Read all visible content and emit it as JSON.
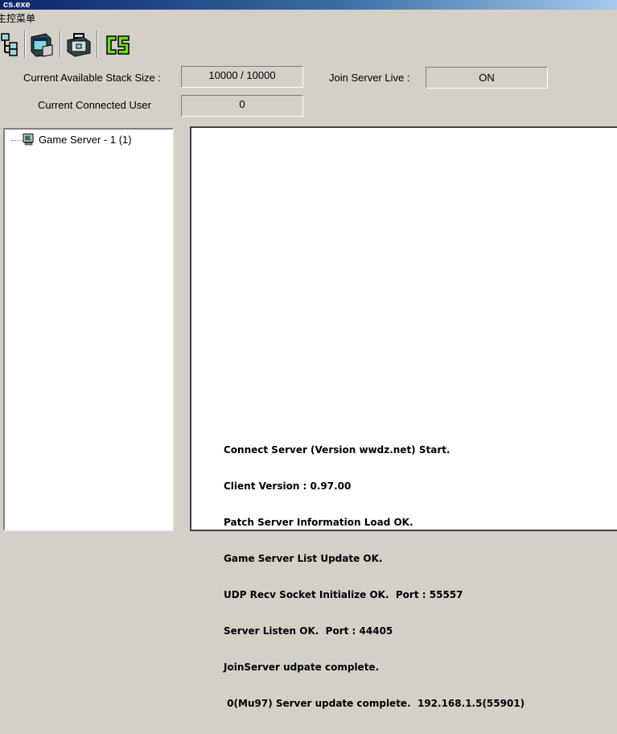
{
  "window": {
    "title": "cs.exe"
  },
  "menu": {
    "items": [
      "主控菜单"
    ]
  },
  "toolbar": {
    "buttons": [
      {
        "icon": "network-tree-icon"
      },
      {
        "icon": "window-icon"
      },
      {
        "icon": "briefcase-icon"
      },
      {
        "icon": "cs-logo-icon"
      }
    ]
  },
  "status": {
    "stack_label": "Current Available Stack Size :",
    "stack_value": "10000 / 10000",
    "connected_label": "Current Connected User",
    "connected_value": "0",
    "join_label": "Join Server Live :",
    "join_value": "ON"
  },
  "tree": {
    "items": [
      {
        "label": "Game Server - 1 (1)",
        "icon": "computer-icon"
      }
    ]
  },
  "log": {
    "lines": [
      "Connect Server (Version wwdz.net) Start.",
      "Client Version : 0.97.00",
      "Patch Server Information Load OK.",
      "Game Server List Update OK.",
      "UDP Recv Socket Initialize OK.  Port : 55557",
      "Server Listen OK.  Port : 44405",
      "JoinServer udpate complete.",
      " 0(Mu97) Server update complete.  192.168.1.5(55901)"
    ]
  },
  "colors": {
    "face": "#d4d0c8",
    "titlebar_start": "#0a246a",
    "titlebar_end": "#a6caf0",
    "cs_logo": "#6fdc1c"
  }
}
